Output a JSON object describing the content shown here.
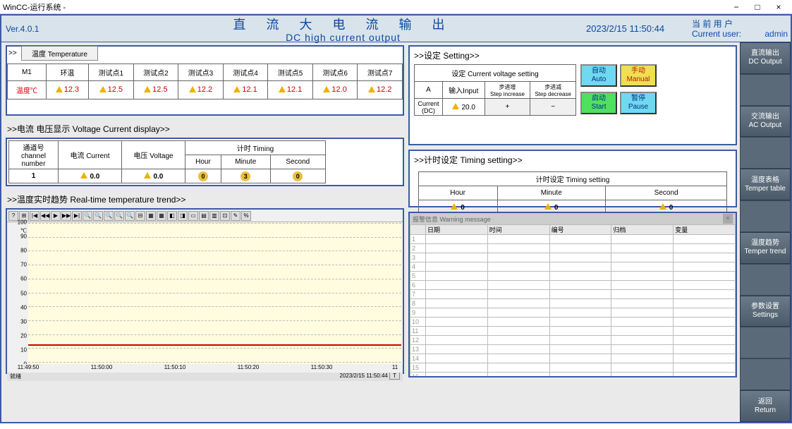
{
  "window_title": "WinCC-运行系统 -",
  "version": "Ver.4.0.1",
  "title_cn": "直 流 大 电 流 输 出",
  "title_en": "DC high current output",
  "datetime": "2023/2/15 11:50:44",
  "user_label_cn": "当 前 用 户",
  "user_label_en": "Current user:",
  "username": "admin",
  "temp_tab": "温度 Temperature",
  "temp": {
    "cols": [
      "M1",
      "环温",
      "测试点1",
      "测试点2",
      "测试点3",
      "测试点4",
      "测试点5",
      "测试点6",
      "测试点7"
    ],
    "row_label": "温度℃",
    "values": [
      "12.3",
      "12.5",
      "12.5",
      "12.2",
      "12.1",
      "12.1",
      "12.0",
      "12.2"
    ]
  },
  "vc_section": ">>电流 电压显示 Voltage Current display>>",
  "vc": {
    "ch_label": "通道号\nchannel number",
    "current_label": "电流  Current",
    "voltage_label": "电压  Voltage",
    "timing_label": "计时 Timing",
    "hour": "Hour",
    "minute": "Minute",
    "second": "Second",
    "ch": "1",
    "current": "0.0",
    "voltage": "0.0",
    "h": "0",
    "m": "3",
    "s": "0"
  },
  "trend_section": ">>温度实时趋势 Real-time temperature trend>>",
  "setting_section": ">>设定 Setting>>",
  "setting": {
    "header": "设定 Current voltage setting",
    "a": "A",
    "input": "输入Input",
    "step_inc": "步进增\nStep increase",
    "step_dec": "步进减\nStep decrease",
    "current_dc": "Current\n(DC)",
    "value": "20.0",
    "plus": "+",
    "minus": "−"
  },
  "btn_auto_cn": "自动",
  "btn_auto_en": "Auto",
  "btn_manual_cn": "手动",
  "btn_manual_en": "Manual",
  "btn_start_cn": "启动",
  "btn_start_en": "Start",
  "btn_pause_cn": "暂停",
  "btn_pause_en": "Pause",
  "timing_section": ">>计时设定 Timing setting>>",
  "timing": {
    "header": "计时设定 Timing setting",
    "hour": "Hour",
    "minute": "Minute",
    "second": "Second",
    "h": "0",
    "m": "0",
    "s": "0"
  },
  "alarm_title": "报警信息 Warning message",
  "alarm_cols": [
    "",
    "日期",
    "时间",
    "编号",
    "归档",
    "变量"
  ],
  "nav": [
    {
      "cn": "直流输出",
      "en": "DC Output"
    },
    {
      "cn": "交流输出",
      "en": "AC Output"
    },
    {
      "cn": "温度表格",
      "en": "Temper table"
    },
    {
      "cn": "温度趋势",
      "en": "Temper trend"
    },
    {
      "cn": "参数设置",
      "en": "Settings"
    },
    {
      "cn": "返回",
      "en": "Return"
    }
  ],
  "chart_data": {
    "type": "line",
    "title": "温度实时趋势 Real-time temperature trend",
    "xlabel": "",
    "ylabel": "℃",
    "ylim": [
      0,
      100
    ],
    "y_ticks": [
      0,
      10,
      20,
      30,
      40,
      50,
      60,
      70,
      80,
      90,
      100
    ],
    "x_ticks": [
      "11:49:50",
      "11:50:00",
      "11:50:10",
      "11:50:20",
      "11:50:30",
      "11"
    ],
    "series": [
      {
        "name": "温度",
        "color": "#c00",
        "values": [
          12,
          12,
          12,
          12,
          12,
          12
        ]
      }
    ],
    "status_left": "就绪",
    "status_right": "2023/2/15 11:50:44",
    "status_t": "T"
  }
}
